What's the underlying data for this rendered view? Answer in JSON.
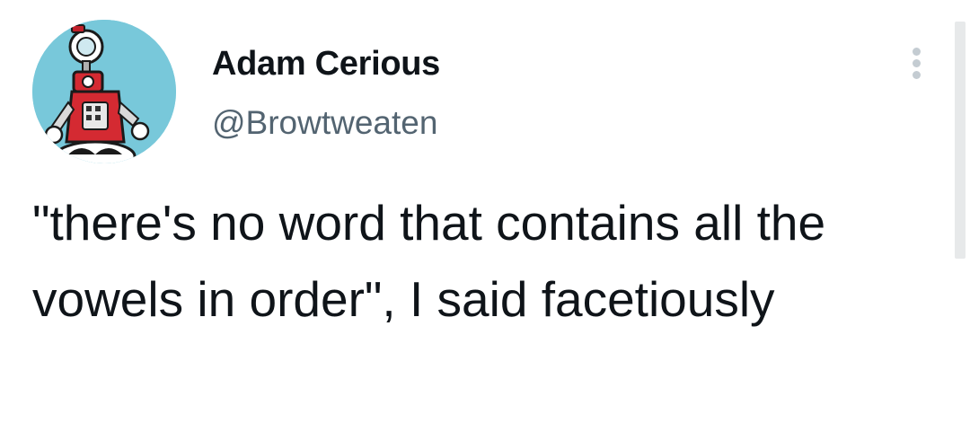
{
  "author": {
    "display_name": "Adam Cerious",
    "handle": "@Browtweaten",
    "avatar_icon": "robot-avatar-icon",
    "avatar_bg_color": "#78c8da"
  },
  "tweet": {
    "text": "\"there's no word that contains all the vowels in order\", I said facetiously"
  },
  "menu": {
    "icon": "more-options-icon"
  },
  "colors": {
    "text_primary": "#0f1419",
    "text_secondary": "#536471",
    "background": "#ffffff"
  }
}
